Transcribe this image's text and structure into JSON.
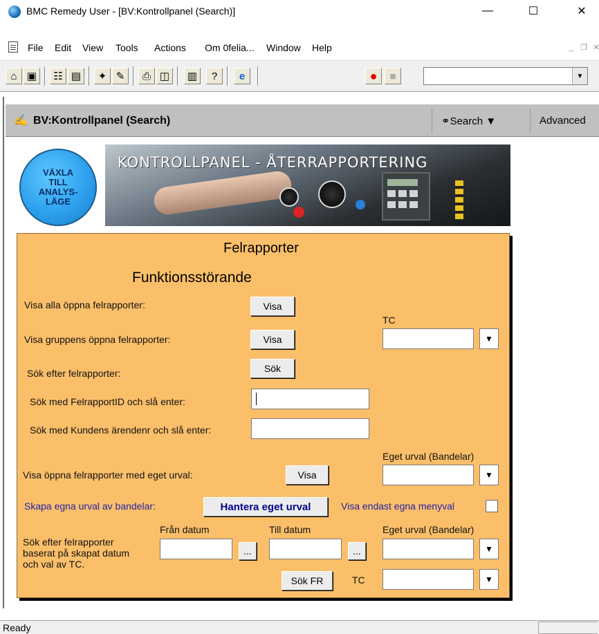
{
  "window": {
    "title": "BMC Remedy User - [BV:Kontrollpanel (Search)]",
    "minimize": "—",
    "maximize": "☐",
    "close": "✕"
  },
  "menu": {
    "items": [
      "File",
      "Edit",
      "View",
      "Tools",
      "Actions",
      "Om 0felia...",
      "Window",
      "Help"
    ]
  },
  "toolbar": {
    "combo_value": "",
    "icons": [
      "home-icon",
      "open-form-icon",
      "new-request-icon",
      "properties-icon",
      "search-icon",
      "edit-icon",
      "print-icon",
      "preview-icon",
      "report-icon",
      "help-icon",
      "browser-icon",
      "record-icon",
      "stop-icon"
    ]
  },
  "form_header": {
    "title": "BV:Kontrollpanel (Search)",
    "search": "Search",
    "advanced": "Advanced"
  },
  "banner": {
    "circle_lines": [
      "VÄXLA",
      "TILL",
      "ANALYS-",
      "LÄGE"
    ],
    "title": "KONTROLLPANEL - ÅTERRAPPORTERING"
  },
  "form": {
    "heading1": "Felrapporter",
    "heading2": "Funktionsstörande",
    "show_all_label": "Visa alla öppna felrapporter:",
    "show_all_btn": "Visa",
    "tc_label": "TC",
    "show_group_label": "Visa gruppens öppna felrapporter:",
    "show_group_btn": "Visa",
    "search_label": "Sök efter felrapporter:",
    "search_btn": "Sök",
    "id_label": "Sök med FelrapportID och slå enter:",
    "id_value": "",
    "customer_label": "Sök med Kundens ärendenr och slå enter:",
    "customer_value": "",
    "custom_select_label": "Eget urval (Bandelar)",
    "show_custom_label": "Visa öppna felrapporter med eget urval:",
    "show_custom_btn": "Visa",
    "create_label": "Skapa egna urval av bandelar:",
    "manage_btn": "Hantera eget urval",
    "own_menu_label": "Visa endast egna menyval",
    "date_search_label": [
      "Sök efter felrapporter",
      "baserat på skapat datum",
      "och val av TC."
    ],
    "from_date_label": "Från datum",
    "to_date_label": "Till datum",
    "ellipsis": "...",
    "custom_select_label2": "Eget urval  (Bandelar)",
    "search_fr_btn": "Sök FR",
    "tc_label2": "TC"
  },
  "status": {
    "text": "Ready"
  }
}
